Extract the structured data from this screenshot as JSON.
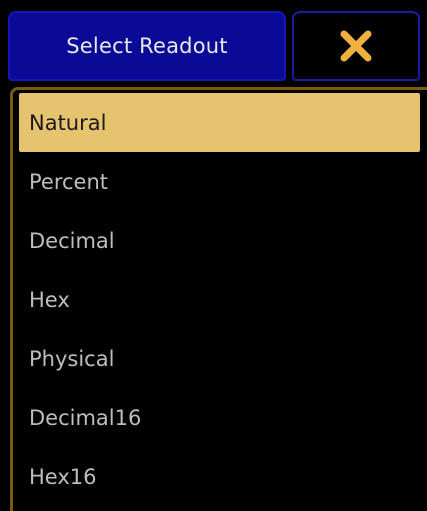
{
  "dialog": {
    "title": "Select Readout",
    "close_icon": "close-x-icon",
    "accent_color": "#f0b040",
    "title_bg": "#0a0a96",
    "selected_bg": "#e6c36e"
  },
  "readout_options": [
    {
      "label": "Natural",
      "selected": true
    },
    {
      "label": "Percent",
      "selected": false
    },
    {
      "label": "Decimal",
      "selected": false
    },
    {
      "label": "Hex",
      "selected": false
    },
    {
      "label": "Physical",
      "selected": false
    },
    {
      "label": "Decimal16",
      "selected": false
    },
    {
      "label": "Hex16",
      "selected": false
    }
  ]
}
